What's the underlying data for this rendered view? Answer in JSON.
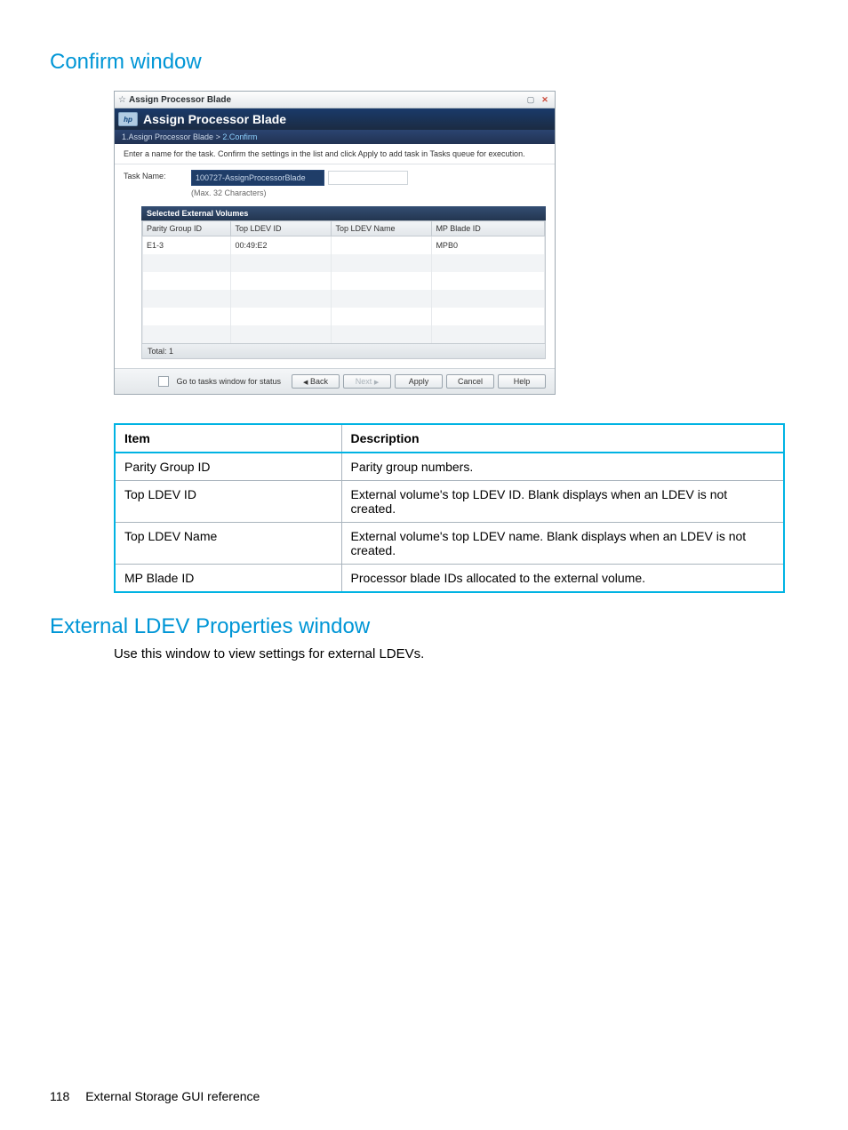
{
  "headings": {
    "confirm": "Confirm window",
    "external": "External LDEV Properties window"
  },
  "external_text": "Use this window to view settings for external LDEVs.",
  "dialog": {
    "titlebar": "Assign Processor Blade",
    "pin_glyph": "☆",
    "max_glyph": "▢",
    "close_glyph": "✕",
    "hp_logo": "hp",
    "header": "Assign Processor Blade",
    "crumb_step1": "1.Assign Processor Blade",
    "crumb_sep": ">",
    "crumb_step2": "2.Confirm",
    "instruction": "Enter a name for the task. Confirm the settings in the list and click Apply to add task in Tasks queue for execution.",
    "task_label": "Task Name:",
    "task_value": "100727-AssignProcessorBlade",
    "task_hint": "(Max. 32 Characters)",
    "selected_header": "Selected External Volumes",
    "cols": {
      "c1": "Parity Group ID",
      "c2": "Top LDEV ID",
      "c3": "Top LDEV Name",
      "c4": "MP Blade ID"
    },
    "row": {
      "c1": "E1-3",
      "c2": "00:49:E2",
      "c3": "",
      "c4": "MPB0"
    },
    "total": "Total: 1",
    "footer_check": "Go to tasks window for status",
    "buttons": {
      "back": "Back",
      "next": "Next",
      "apply": "Apply",
      "cancel": "Cancel",
      "help": "Help"
    }
  },
  "desc_table": {
    "h1": "Item",
    "h2": "Description",
    "rows": [
      {
        "item": "Parity Group ID",
        "desc": "Parity group numbers."
      },
      {
        "item": "Top LDEV ID",
        "desc": "External volume's top LDEV ID. Blank displays when an LDEV is not created."
      },
      {
        "item": "Top LDEV Name",
        "desc": "External volume's top LDEV name. Blank displays when an LDEV is not created."
      },
      {
        "item": "MP Blade ID",
        "desc": "Processor blade IDs allocated to the external volume."
      }
    ]
  },
  "footer": {
    "page": "118",
    "section": "External Storage GUI reference"
  }
}
